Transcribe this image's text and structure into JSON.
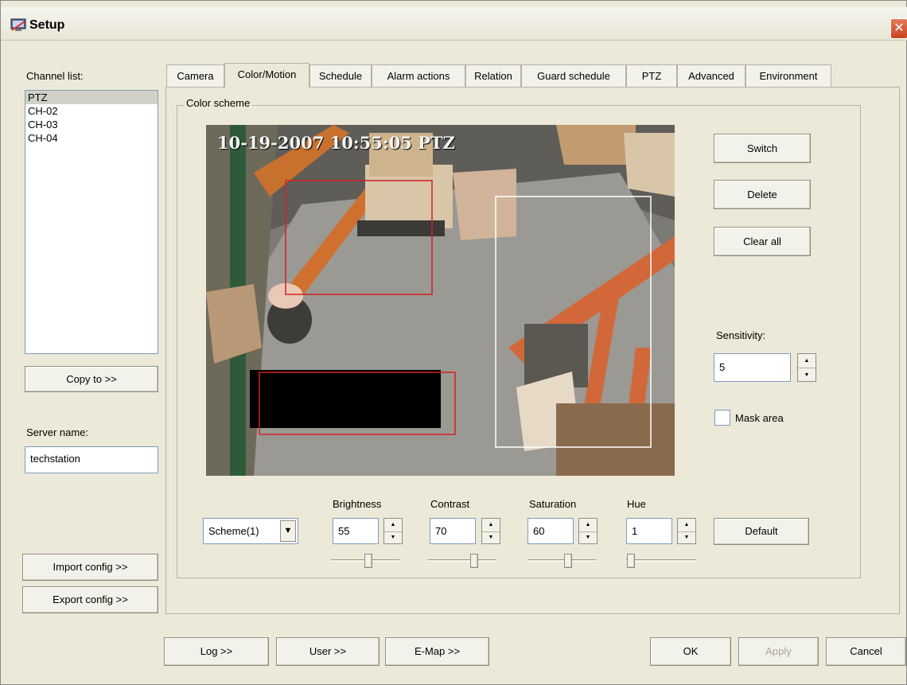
{
  "window": {
    "title": "Setup",
    "close_glyph": "✕"
  },
  "sidebar": {
    "channel_list_label": "Channel list:",
    "channels": [
      "PTZ",
      "CH-02",
      "CH-03",
      "CH-04"
    ],
    "selected_channel": "PTZ",
    "copy_to_label": "Copy to >>",
    "server_name_label": "Server name:",
    "server_name_value": "techstation",
    "import_label": "Import config >>",
    "export_label": "Export config >>"
  },
  "tabs": [
    "Camera",
    "Color/Motion",
    "Schedule",
    "Alarm actions",
    "Relation",
    "Guard schedule",
    "PTZ",
    "Advanced",
    "Environment"
  ],
  "active_tab": "Color/Motion",
  "color_scheme": {
    "group_label": "Color scheme",
    "video_overlay": "10-19-2007 10:55:05 PTZ",
    "switch_label": "Switch",
    "delete_label": "Delete",
    "clear_all_label": "Clear all",
    "sensitivity_label": "Sensitivity:",
    "sensitivity_value": "5",
    "mask_area_label": "Mask area",
    "scheme_value": "Scheme(1)",
    "default_label": "Default",
    "controls": [
      {
        "label": "Brightness",
        "value": "55",
        "slider_fraction": 0.55
      },
      {
        "label": "Contrast",
        "value": "70",
        "slider_fraction": 0.7
      },
      {
        "label": "Saturation",
        "value": "60",
        "slider_fraction": 0.6
      },
      {
        "label": "Hue",
        "value": "1",
        "slider_fraction": 0.01
      }
    ]
  },
  "footer": {
    "log_label": "Log >>",
    "user_label": "User >>",
    "emap_label": "E-Map >>",
    "ok_label": "OK",
    "apply_label": "Apply",
    "cancel_label": "Cancel"
  },
  "icons": {
    "spin_up": "▲",
    "spin_down": "▼",
    "combo_arrow": "▼"
  },
  "colors": {
    "motion_region": "#d32020",
    "mask_region": "#000000",
    "selection_region": "#ffffff"
  }
}
